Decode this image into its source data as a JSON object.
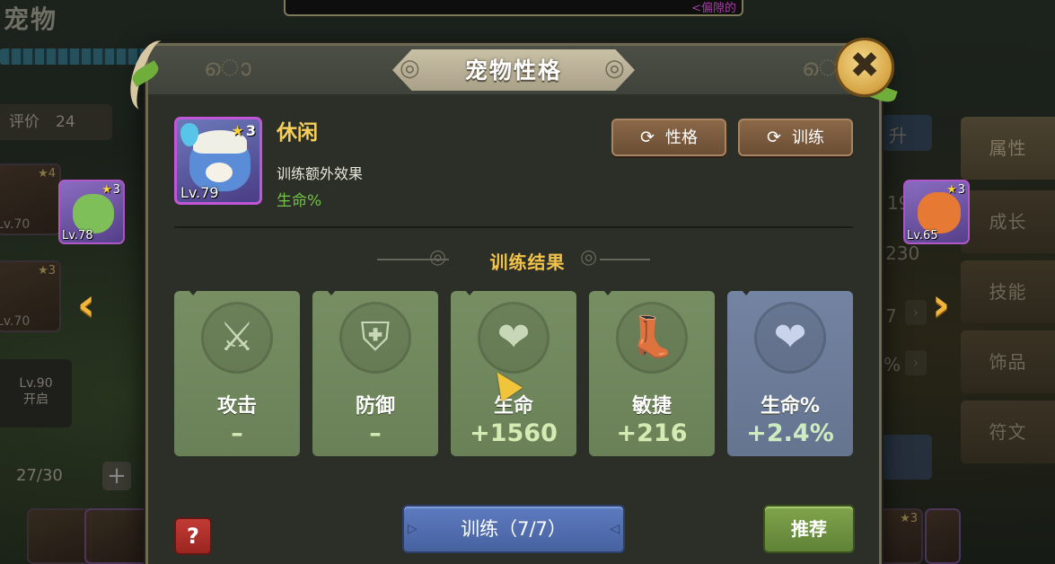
{
  "background": {
    "page_title": "宠物",
    "top_banner_text": "<偏隙的",
    "rating_label": "评价",
    "rating_value": "24",
    "left_pets": [
      {
        "level": "Lv.70",
        "stars": "4"
      },
      {
        "level": "Lv.70",
        "stars": "3"
      }
    ],
    "locked_slot": {
      "level": "Lv.90",
      "label": "开启"
    },
    "pet_count": "27/30",
    "plus": "+",
    "side_tabs": [
      "属性",
      "成长",
      "技能",
      "饰品",
      "符文"
    ],
    "right_fragments": [
      "升",
      "19",
      "230",
      "7",
      "%"
    ],
    "bottom_right_stars": "3"
  },
  "prev_pet": {
    "level": "Lv.78",
    "stars": "3"
  },
  "next_pet": {
    "level": "Lv.65",
    "stars": "3"
  },
  "nav": {
    "prev_arrow": "‹",
    "next_arrow": "›"
  },
  "dialog": {
    "title": "宠物性格",
    "close_icon": "✖",
    "pet": {
      "level": "Lv.79",
      "stars": "3"
    },
    "personality_name": "休闲",
    "bonus_label": "训练额外效果",
    "bonus_value": "生命%",
    "buttons": {
      "personality": "性格",
      "training": "训练",
      "train_action": "训练（7/7）",
      "recommend": "推荐",
      "help": "?"
    },
    "icons": {
      "refresh": "⟳"
    },
    "section_title": "训练结果",
    "stats": [
      {
        "name": "攻击",
        "value": "–",
        "icon": "sword-icon",
        "glyph": "⚔"
      },
      {
        "name": "防御",
        "value": "–",
        "icon": "shield-icon",
        "glyph": "⛨"
      },
      {
        "name": "生命",
        "value": "+1560",
        "icon": "heart-plus-icon",
        "glyph": "❤"
      },
      {
        "name": "敏捷",
        "value": "+216",
        "icon": "boot-icon",
        "glyph": "👢"
      },
      {
        "name": "生命%",
        "value": "+2.4%",
        "icon": "heart-up-icon",
        "glyph": "❤"
      }
    ]
  },
  "colors": {
    "accent_gold": "#f2c34a",
    "bonus_green": "#74c247",
    "stat_green": "#778e63",
    "stat_blue": "#7383a2",
    "train_blue": "#5d7bc0",
    "recommend_green": "#7fa44c",
    "help_red": "#c23b36"
  }
}
